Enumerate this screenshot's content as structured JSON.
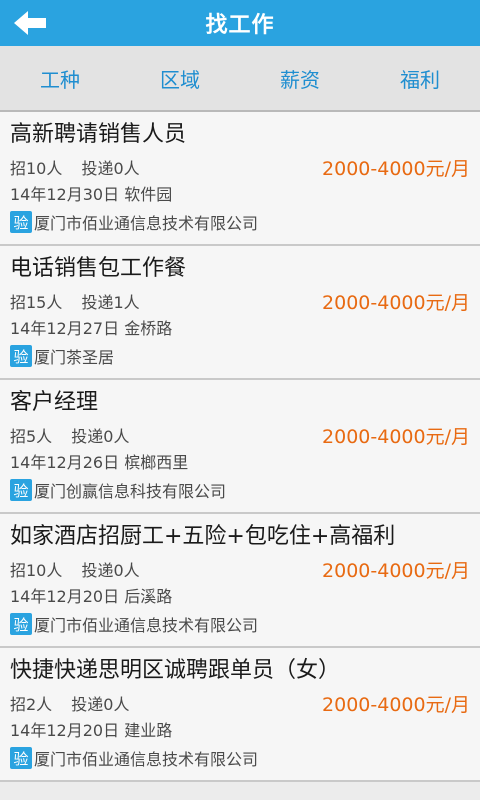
{
  "header": {
    "title": "找工作"
  },
  "filters": [
    "工种",
    "区域",
    "薪资",
    "福利"
  ],
  "jobs": [
    {
      "title": "高新聘请销售人员",
      "openings": "招10人",
      "applied": "投递0人",
      "salary": "2000-4000元/月",
      "date": "14年12月30日",
      "location": "软件园",
      "badge": "验",
      "company": "厦门市佰业通信息技术有限公司"
    },
    {
      "title": "电话销售包工作餐",
      "openings": "招15人",
      "applied": "投递1人",
      "salary": "2000-4000元/月",
      "date": "14年12月27日",
      "location": "金桥路",
      "badge": "验",
      "company": "厦门茶圣居"
    },
    {
      "title": "客户经理",
      "openings": "招5人",
      "applied": "投递0人",
      "salary": "2000-4000元/月",
      "date": "14年12月26日",
      "location": "槟榔西里",
      "badge": "验",
      "company": "厦门创赢信息科技有限公司"
    },
    {
      "title": "如家酒店招厨工+五险+包吃住+高福利",
      "openings": "招10人",
      "applied": "投递0人",
      "salary": "2000-4000元/月",
      "date": "14年12月20日",
      "location": "后溪路",
      "badge": "验",
      "company": "厦门市佰业通信息技术有限公司"
    },
    {
      "title": "快捷快递思明区诚聘跟单员（女）",
      "openings": "招2人",
      "applied": "投递0人",
      "salary": "2000-4000元/月",
      "date": "14年12月20日",
      "location": "建业路",
      "badge": "验",
      "company": "厦门市佰业通信息技术有限公司"
    }
  ],
  "colors": {
    "header": "#2aa3e0",
    "accent": "#1f8ed0",
    "salary": "#e86a12"
  },
  "icons": {
    "back": "back-arrow-icon"
  }
}
